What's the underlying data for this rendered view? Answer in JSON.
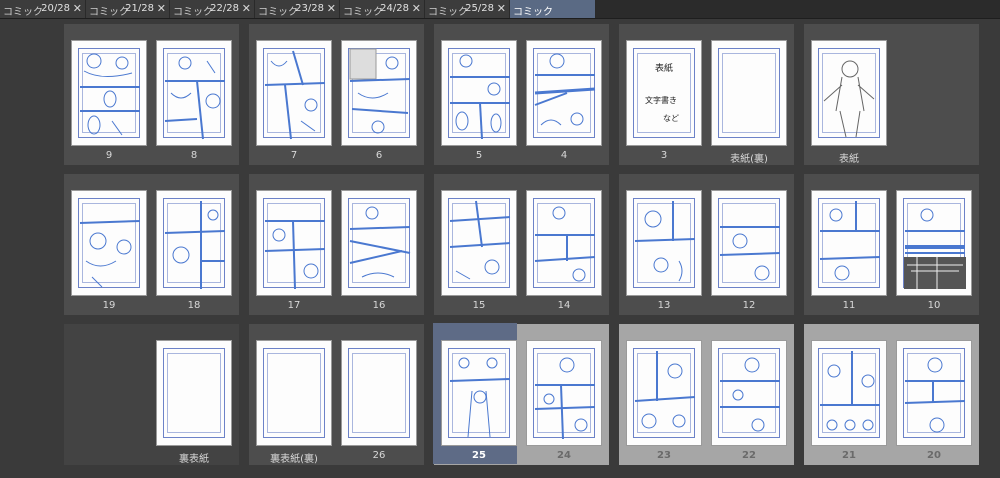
{
  "tabs": [
    {
      "name": "コミック",
      "num": "20/28",
      "close": "✕"
    },
    {
      "name": "コミック",
      "num": "21/28",
      "close": "✕"
    },
    {
      "name": "コミック",
      "num": "22/28",
      "close": "✕"
    },
    {
      "name": "コミック",
      "num": "23/28",
      "close": "✕"
    },
    {
      "name": "コミック",
      "num": "24/28",
      "close": "✕"
    },
    {
      "name": "コミック",
      "num": "25/28",
      "close": "✕"
    },
    {
      "name": "コミック",
      "num": "",
      "close": ""
    }
  ],
  "row1": {
    "s1": {
      "left": "9",
      "right": "8"
    },
    "s2": {
      "left": "7",
      "right": "6"
    },
    "s3": {
      "left": "5",
      "right": "4"
    },
    "s4": {
      "left": "3",
      "right": "表紙(裏)"
    },
    "s5": {
      "left": "表紙"
    }
  },
  "row2": {
    "s1": {
      "left": "19",
      "right": "18"
    },
    "s2": {
      "left": "17",
      "right": "16"
    },
    "s3": {
      "left": "15",
      "right": "14"
    },
    "s4": {
      "left": "13",
      "right": "12"
    },
    "s5": {
      "left": "11",
      "right": "10"
    }
  },
  "row3": {
    "s1": {
      "right": "裏表紙"
    },
    "s2": {
      "left": "裏表紙(裏)",
      "right": "26"
    },
    "s3": {
      "left": "25",
      "right": "24"
    },
    "s4": {
      "left": "23",
      "right": "22"
    },
    "s5": {
      "left": "21",
      "right": "20"
    }
  },
  "page3_text": {
    "line1": "表紙",
    "line2": "文字書き",
    "line3": "など"
  },
  "colors": {
    "accent": "#5a6a84",
    "sketch": "#4a78d0",
    "selected_spread": "#a6a6a6"
  }
}
